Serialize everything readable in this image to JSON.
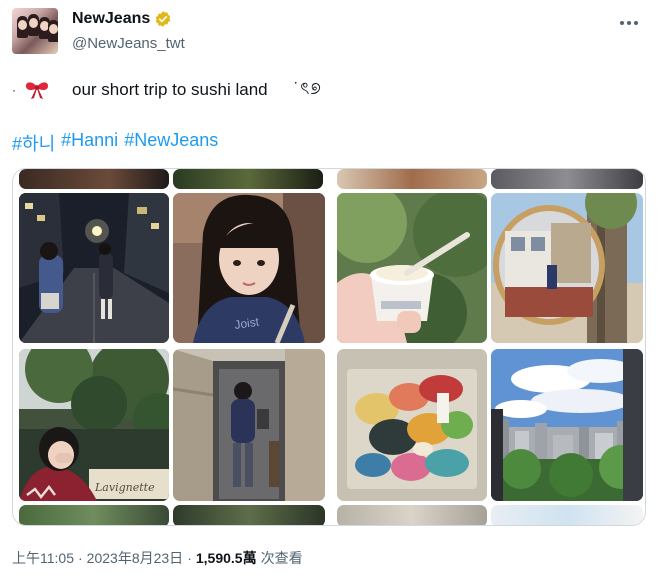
{
  "author": {
    "name": "NewJeans",
    "handle": "@NewJeans_twt"
  },
  "tweet": {
    "lead_dot": "·",
    "text": "our short trip to sushi land",
    "trailing_glyphs": "˙ৎ୭",
    "hashtags": [
      "#하니",
      "#Hanni",
      "#NewJeans"
    ]
  },
  "media": {
    "photos": [
      "night-street-photo",
      "selfie-photo",
      "girl-under-trees-photo",
      "hallway-mirror-photo",
      "ice-cream-cup-photo",
      "round-mirror-photo",
      "paint-palette-photo",
      "city-view-photo"
    ],
    "signboard_text": "Lavignette"
  },
  "footer": {
    "time": "上午11:05",
    "sep1": "·",
    "date": "2023年8月23日",
    "sep2": "·",
    "views_count": "1,590.5萬",
    "views_label": "次查看"
  },
  "colors": {
    "link": "#1d9bf0",
    "muted": "#536471",
    "text": "#0f1419",
    "verified_badge": "#e2b719"
  }
}
